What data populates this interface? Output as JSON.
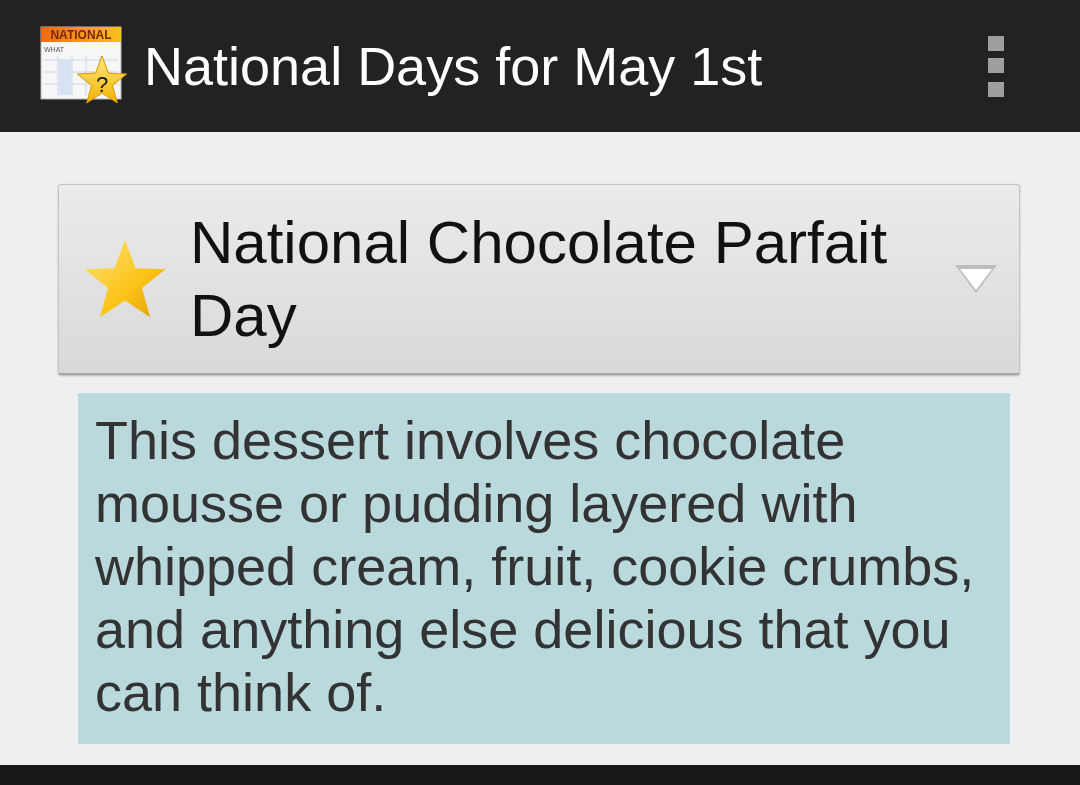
{
  "app_bar": {
    "app_icon": {
      "banner": "NATIONAL",
      "label": "WHAT",
      "mark": "?"
    },
    "title": "National Days for May 1st"
  },
  "day_card": {
    "title": "National Chocolate Parfait Day",
    "expanded": true,
    "description": "This dessert involves chocolate mousse or pudding layered with whipped cream, fruit, cookie crumbs, and anything else delicious that you can think of."
  }
}
